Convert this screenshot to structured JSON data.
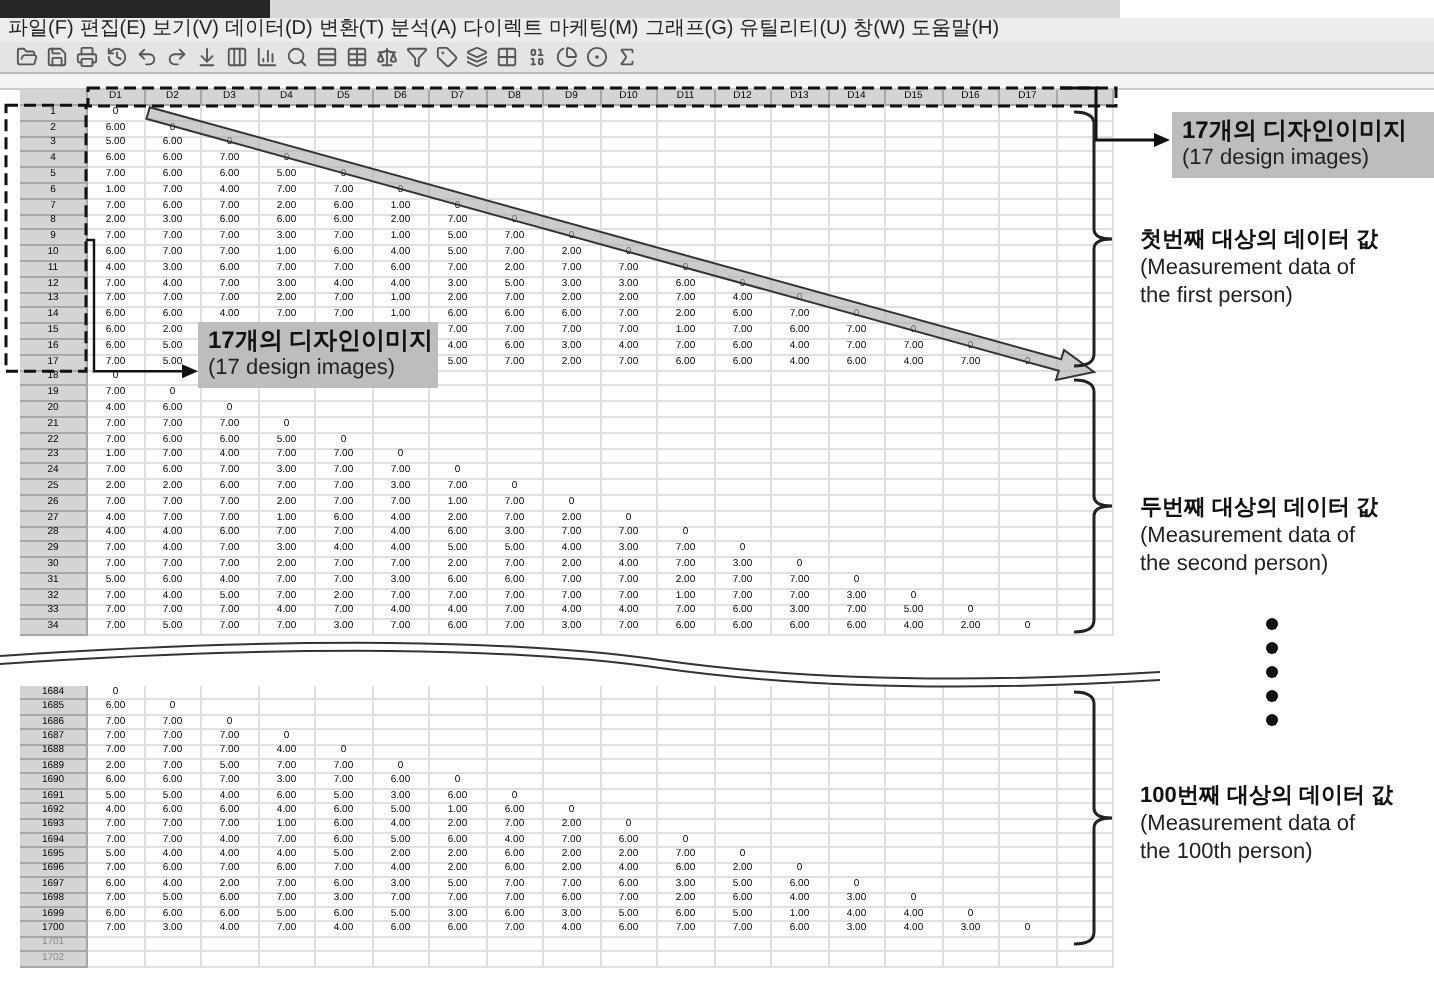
{
  "menu": [
    "파일(F)",
    "편집(E)",
    "보기(V)",
    "데이터(D)",
    "변환(T)",
    "분석(A)",
    "다이렉트 마케팅(M)",
    "그래프(G)",
    "유틸리티(U)",
    "창(W)",
    "도움말(H)"
  ],
  "columns": [
    "D1",
    "D2",
    "D3",
    "D4",
    "D5",
    "D6",
    "D7",
    "D8",
    "D9",
    "D10",
    "D11",
    "D12",
    "D13",
    "D14",
    "D15",
    "D16",
    "D17"
  ],
  "rows": [
    {
      "number": "1",
      "cells": [
        "0"
      ]
    },
    {
      "number": "2",
      "cells": [
        "6.00",
        "0"
      ]
    },
    {
      "number": "3",
      "cells": [
        "5.00",
        "6.00",
        "0"
      ]
    },
    {
      "number": "4",
      "cells": [
        "6.00",
        "6.00",
        "7.00",
        "0"
      ]
    },
    {
      "number": "5",
      "cells": [
        "7.00",
        "6.00",
        "6.00",
        "5.00",
        "0"
      ]
    },
    {
      "number": "6",
      "cells": [
        "1.00",
        "7.00",
        "4.00",
        "7.00",
        "7.00",
        "0"
      ]
    },
    {
      "number": "7",
      "cells": [
        "7.00",
        "6.00",
        "7.00",
        "2.00",
        "6.00",
        "1.00",
        "0"
      ]
    },
    {
      "number": "8",
      "cells": [
        "2.00",
        "3.00",
        "6.00",
        "6.00",
        "6.00",
        "2.00",
        "7.00",
        "0"
      ]
    },
    {
      "number": "9",
      "cells": [
        "7.00",
        "7.00",
        "7.00",
        "3.00",
        "7.00",
        "1.00",
        "5.00",
        "7.00",
        "0"
      ]
    },
    {
      "number": "10",
      "cells": [
        "6.00",
        "7.00",
        "7.00",
        "1.00",
        "6.00",
        "4.00",
        "5.00",
        "7.00",
        "2.00",
        "0"
      ]
    },
    {
      "number": "11",
      "cells": [
        "4.00",
        "3.00",
        "6.00",
        "7.00",
        "7.00",
        "6.00",
        "7.00",
        "2.00",
        "7.00",
        "7.00",
        "0"
      ]
    },
    {
      "number": "12",
      "cells": [
        "7.00",
        "4.00",
        "7.00",
        "3.00",
        "4.00",
        "4.00",
        "3.00",
        "5.00",
        "3.00",
        "3.00",
        "6.00",
        "0"
      ]
    },
    {
      "number": "13",
      "cells": [
        "7.00",
        "7.00",
        "7.00",
        "2.00",
        "7.00",
        "1.00",
        "2.00",
        "7.00",
        "2.00",
        "2.00",
        "7.00",
        "4.00",
        "0"
      ]
    },
    {
      "number": "14",
      "cells": [
        "6.00",
        "6.00",
        "4.00",
        "7.00",
        "7.00",
        "1.00",
        "6.00",
        "6.00",
        "6.00",
        "7.00",
        "2.00",
        "6.00",
        "7.00",
        "0"
      ]
    },
    {
      "number": "15",
      "cells": [
        "6.00",
        "2.00",
        null,
        null,
        null,
        null,
        "7.00",
        "7.00",
        "7.00",
        "7.00",
        "1.00",
        "7.00",
        "6.00",
        "7.00",
        "0"
      ]
    },
    {
      "number": "16",
      "cells": [
        "6.00",
        "5.00",
        null,
        null,
        null,
        null,
        "4.00",
        "6.00",
        "3.00",
        "4.00",
        "7.00",
        "6.00",
        "4.00",
        "7.00",
        "7.00",
        "0"
      ]
    },
    {
      "number": "17",
      "cells": [
        "7.00",
        "5.00",
        null,
        null,
        null,
        null,
        "5.00",
        "7.00",
        "2.00",
        "7.00",
        "6.00",
        "6.00",
        "4.00",
        "6.00",
        "4.00",
        "7.00",
        "0"
      ]
    },
    {
      "number": "18",
      "cells": [
        "0"
      ]
    },
    {
      "number": "19",
      "cells": [
        "7.00",
        "0"
      ]
    },
    {
      "number": "20",
      "cells": [
        "4.00",
        "6.00",
        "0"
      ]
    },
    {
      "number": "21",
      "cells": [
        "7.00",
        "7.00",
        "7.00",
        "0"
      ]
    },
    {
      "number": "22",
      "cells": [
        "7.00",
        "6.00",
        "6.00",
        "5.00",
        "0"
      ]
    },
    {
      "number": "23",
      "cells": [
        "1.00",
        "7.00",
        "4.00",
        "7.00",
        "7.00",
        "0"
      ]
    },
    {
      "number": "24",
      "cells": [
        "7.00",
        "6.00",
        "7.00",
        "3.00",
        "7.00",
        "7.00",
        "0"
      ]
    },
    {
      "number": "25",
      "cells": [
        "2.00",
        "2.00",
        "6.00",
        "7.00",
        "7.00",
        "3.00",
        "7.00",
        "0"
      ]
    },
    {
      "number": "26",
      "cells": [
        "7.00",
        "7.00",
        "7.00",
        "2.00",
        "7.00",
        "7.00",
        "1.00",
        "7.00",
        "0"
      ]
    },
    {
      "number": "27",
      "cells": [
        "4.00",
        "7.00",
        "7.00",
        "1.00",
        "6.00",
        "4.00",
        "2.00",
        "7.00",
        "2.00",
        "0"
      ]
    },
    {
      "number": "28",
      "cells": [
        "4.00",
        "4.00",
        "6.00",
        "7.00",
        "7.00",
        "4.00",
        "6.00",
        "3.00",
        "7.00",
        "7.00",
        "0"
      ]
    },
    {
      "number": "29",
      "cells": [
        "7.00",
        "4.00",
        "7.00",
        "3.00",
        "4.00",
        "4.00",
        "5.00",
        "5.00",
        "4.00",
        "3.00",
        "7.00",
        "0"
      ]
    },
    {
      "number": "30",
      "cells": [
        "7.00",
        "7.00",
        "7.00",
        "2.00",
        "7.00",
        "7.00",
        "2.00",
        "7.00",
        "2.00",
        "4.00",
        "7.00",
        "3.00",
        "0"
      ]
    },
    {
      "number": "31",
      "cells": [
        "5.00",
        "6.00",
        "4.00",
        "7.00",
        "7.00",
        "3.00",
        "6.00",
        "6.00",
        "7.00",
        "7.00",
        "2.00",
        "7.00",
        "7.00",
        "0"
      ]
    },
    {
      "number": "32",
      "cells": [
        "7.00",
        "4.00",
        "5.00",
        "7.00",
        "2.00",
        "7.00",
        "7.00",
        "7.00",
        "7.00",
        "7.00",
        "1.00",
        "7.00",
        "7.00",
        "3.00",
        "0"
      ]
    },
    {
      "number": "33",
      "cells": [
        "7.00",
        "7.00",
        "7.00",
        "4.00",
        "7.00",
        "4.00",
        "4.00",
        "7.00",
        "4.00",
        "4.00",
        "7.00",
        "6.00",
        "3.00",
        "7.00",
        "5.00",
        "0"
      ]
    },
    {
      "number": "34",
      "cells": [
        "7.00",
        "5.00",
        "7.00",
        "7.00",
        "3.00",
        "7.00",
        "6.00",
        "7.00",
        "3.00",
        "7.00",
        "6.00",
        "6.00",
        "6.00",
        "6.00",
        "4.00",
        "2.00",
        "0"
      ]
    }
  ],
  "rows_after_break": [
    {
      "number": "1684",
      "cells": [
        "0"
      ]
    },
    {
      "number": "1685",
      "cells": [
        "6.00",
        "0"
      ]
    },
    {
      "number": "1686",
      "cells": [
        "7.00",
        "7.00",
        "0"
      ]
    },
    {
      "number": "1687",
      "cells": [
        "7.00",
        "7.00",
        "7.00",
        "0"
      ]
    },
    {
      "number": "1688",
      "cells": [
        "7.00",
        "7.00",
        "7.00",
        "4.00",
        "0"
      ]
    },
    {
      "number": "1689",
      "cells": [
        "2.00",
        "7.00",
        "5.00",
        "7.00",
        "7.00",
        "0"
      ]
    },
    {
      "number": "1690",
      "cells": [
        "6.00",
        "6.00",
        "7.00",
        "3.00",
        "7.00",
        "6.00",
        "0"
      ]
    },
    {
      "number": "1691",
      "cells": [
        "5.00",
        "5.00",
        "4.00",
        "6.00",
        "5.00",
        "3.00",
        "6.00",
        "0"
      ]
    },
    {
      "number": "1692",
      "cells": [
        "4.00",
        "6.00",
        "6.00",
        "4.00",
        "6.00",
        "5.00",
        "1.00",
        "6.00",
        "0"
      ]
    },
    {
      "number": "1693",
      "cells": [
        "7.00",
        "7.00",
        "7.00",
        "1.00",
        "6.00",
        "4.00",
        "2.00",
        "7.00",
        "2.00",
        "0"
      ]
    },
    {
      "number": "1694",
      "cells": [
        "7.00",
        "7.00",
        "4.00",
        "7.00",
        "6.00",
        "5.00",
        "6.00",
        "4.00",
        "7.00",
        "6.00",
        "0"
      ]
    },
    {
      "number": "1695",
      "cells": [
        "5.00",
        "4.00",
        "4.00",
        "4.00",
        "5.00",
        "2.00",
        "2.00",
        "6.00",
        "2.00",
        "2.00",
        "7.00",
        "0"
      ]
    },
    {
      "number": "1696",
      "cells": [
        "7.00",
        "6.00",
        "7.00",
        "6.00",
        "7.00",
        "4.00",
        "2.00",
        "6.00",
        "2.00",
        "4.00",
        "6.00",
        "2.00",
        "0"
      ]
    },
    {
      "number": "1697",
      "cells": [
        "6.00",
        "4.00",
        "2.00",
        "7.00",
        "6.00",
        "3.00",
        "5.00",
        "7.00",
        "7.00",
        "6.00",
        "3.00",
        "5.00",
        "6.00",
        "0"
      ]
    },
    {
      "number": "1698",
      "cells": [
        "7.00",
        "5.00",
        "6.00",
        "7.00",
        "3.00",
        "7.00",
        "7.00",
        "7.00",
        "6.00",
        "7.00",
        "2.00",
        "6.00",
        "4.00",
        "3.00",
        "0"
      ]
    },
    {
      "number": "1699",
      "cells": [
        "6.00",
        "6.00",
        "6.00",
        "5.00",
        "6.00",
        "5.00",
        "3.00",
        "6.00",
        "3.00",
        "5.00",
        "6.00",
        "5.00",
        "1.00",
        "4.00",
        "4.00",
        "0"
      ]
    },
    {
      "number": "1700",
      "cells": [
        "7.00",
        "3.00",
        "4.00",
        "7.00",
        "4.00",
        "6.00",
        "6.00",
        "7.00",
        "4.00",
        "6.00",
        "7.00",
        "7.00",
        "6.00",
        "3.00",
        "4.00",
        "3.00",
        "0"
      ]
    },
    {
      "number": "1701"
    },
    {
      "number": "1702"
    }
  ],
  "callouts": [
    {
      "title": "17개의 디자인이미지",
      "subtitle": "(17 design images)"
    },
    {
      "title": "17개의 디자인이미지",
      "subtitle": "(17 design images)"
    }
  ],
  "brackets": [
    {
      "title": "첫번째 대상의 데이터 값",
      "subtitle": "(Measurement data of the first person)"
    },
    {
      "title": "두번째 대상의 데이터 값",
      "subtitle": "(Measurement data of the second person)"
    },
    {
      "title": "100번째 대상의 데이터 값",
      "subtitle": "(Measurement data of the 100th person)"
    }
  ]
}
